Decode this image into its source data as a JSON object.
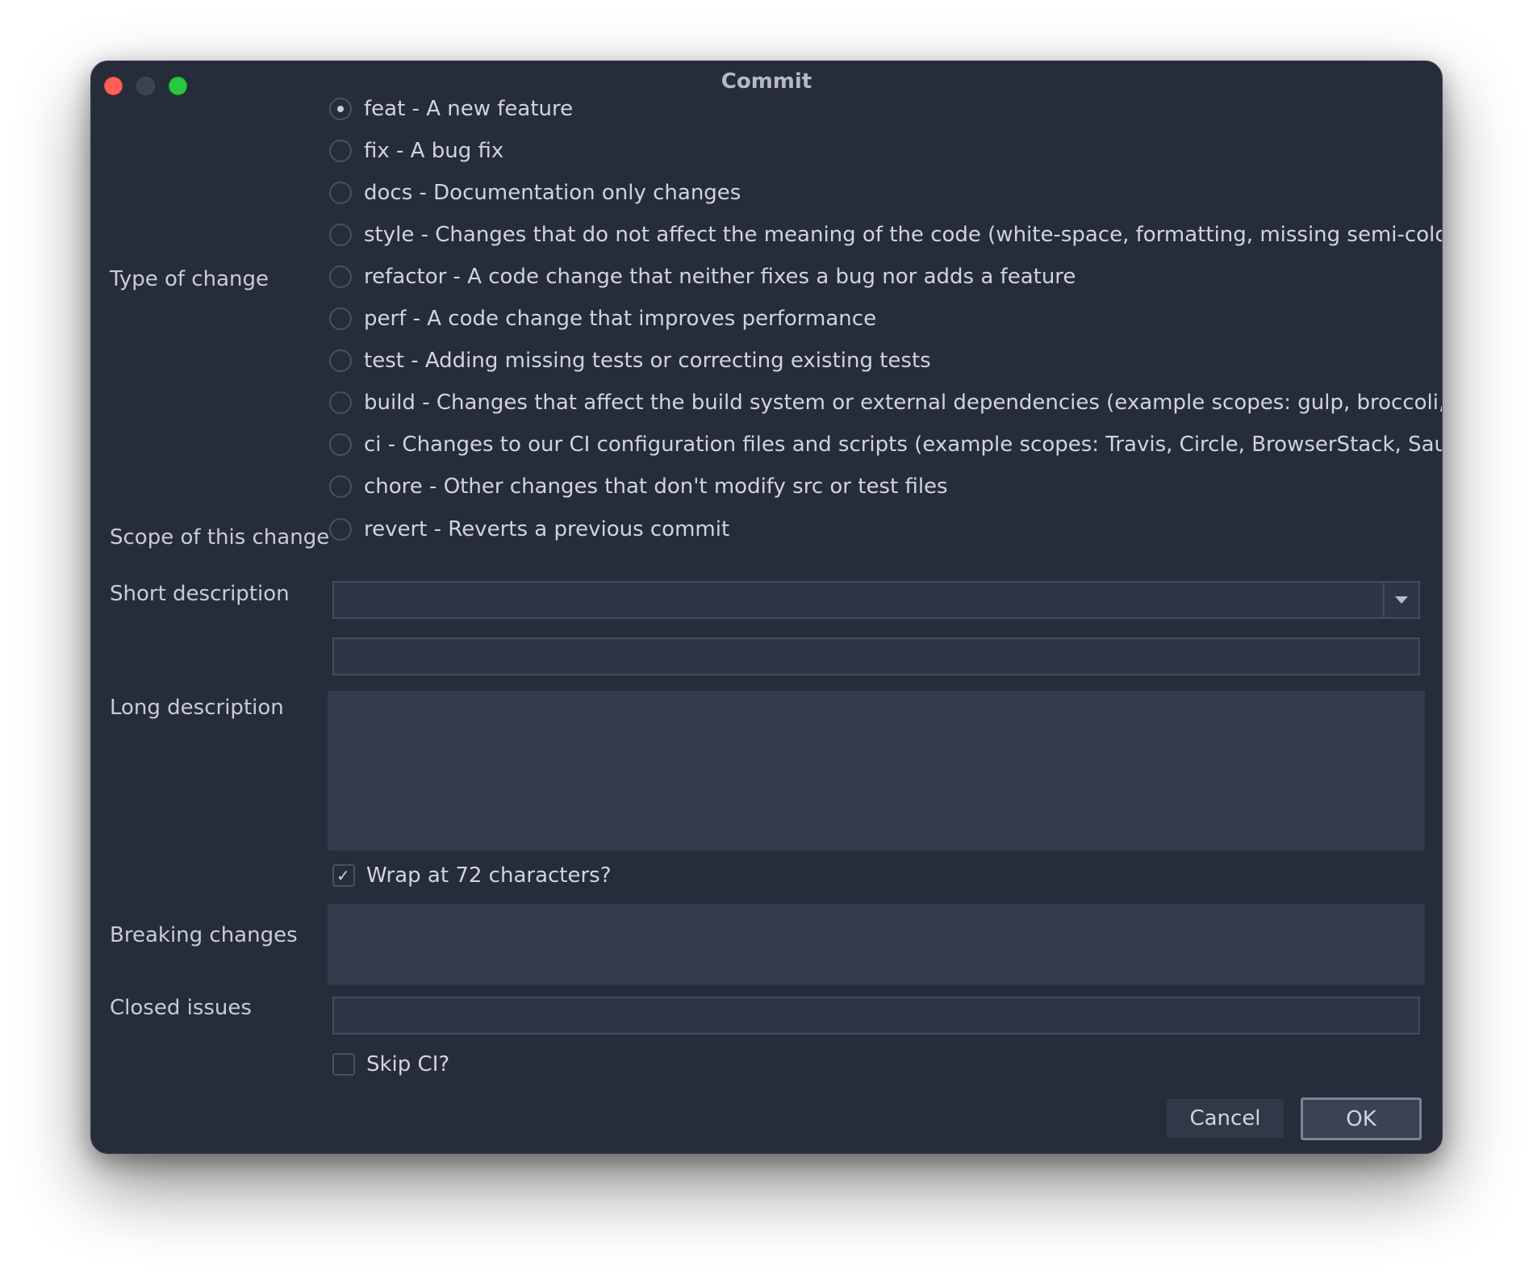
{
  "window": {
    "title": "Commit"
  },
  "type_of_change": {
    "label": "Type of change",
    "selected_index": 0,
    "options": [
      "feat - A new feature",
      "fix - A bug fix",
      "docs - Documentation only changes",
      "style - Changes that do not affect the meaning of the code (white-space, formatting, missing semi-colons, etc)",
      "refactor - A code change that neither fixes a bug nor adds a feature",
      "perf - A code change that improves performance",
      "test - Adding missing tests or correcting existing tests",
      "build - Changes that affect the build system or external dependencies (example scopes: gulp, broccoli, npm)",
      "ci - Changes to our CI configuration files and scripts (example scopes: Travis, Circle, BrowserStack, SauceLabs)",
      "chore - Other changes that don't modify src or test files",
      "revert - Reverts a previous commit"
    ]
  },
  "scope": {
    "label": "Scope of this change",
    "value": ""
  },
  "short_description": {
    "label": "Short description",
    "value": ""
  },
  "long_description": {
    "label": "Long description",
    "value": ""
  },
  "wrap": {
    "label": "Wrap at 72 characters?",
    "checked": true,
    "check_glyph": "✓"
  },
  "breaking_changes": {
    "label": "Breaking changes",
    "value": ""
  },
  "closed_issues": {
    "label": "Closed issues",
    "value": ""
  },
  "skip_ci": {
    "label": "Skip CI?",
    "checked": false
  },
  "buttons": {
    "cancel": "Cancel",
    "ok": "OK"
  },
  "colors": {
    "window_bg": "#262c3a",
    "field_bg": "#2f3546",
    "area_bg": "#353b4c",
    "close": "#ff5f57",
    "maximize": "#28c840"
  }
}
